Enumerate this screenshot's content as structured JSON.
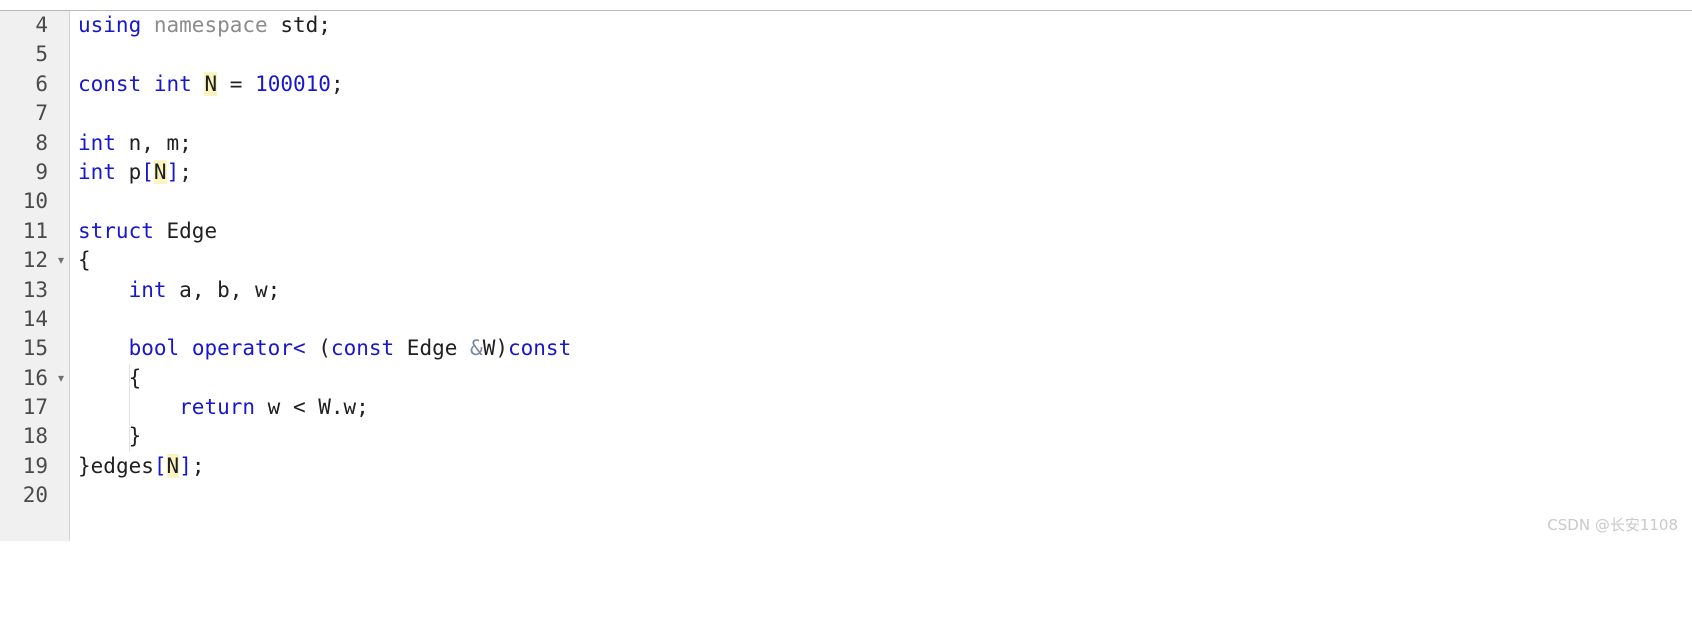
{
  "editor": {
    "language": "cpp",
    "first_visible_line": 4,
    "last_visible_line": 20,
    "gutter_bg": "#f0f0f0",
    "background": "#ffffff",
    "keyword_color": "#1717cf",
    "identifier_color": "#202020",
    "dimmed_color": "#8b8b8b",
    "occurrence_highlight_color": "#fbf3c0",
    "indent_guide_color": "#e2e2e2",
    "fold_marker": "▾"
  },
  "lines": [
    {
      "n": "4",
      "fold": "",
      "text": "using namespace std;"
    },
    {
      "n": "5",
      "fold": "",
      "text": ""
    },
    {
      "n": "6",
      "fold": "",
      "text": "const int N = 100010;"
    },
    {
      "n": "7",
      "fold": "",
      "text": ""
    },
    {
      "n": "8",
      "fold": "",
      "text": "int n, m;"
    },
    {
      "n": "9",
      "fold": "",
      "text": "int p[N];"
    },
    {
      "n": "10",
      "fold": "",
      "text": ""
    },
    {
      "n": "11",
      "fold": "",
      "text": "struct Edge"
    },
    {
      "n": "12",
      "fold": "▾",
      "text": "{"
    },
    {
      "n": "13",
      "fold": "",
      "text": "    int a, b, w;"
    },
    {
      "n": "14",
      "fold": "",
      "text": ""
    },
    {
      "n": "15",
      "fold": "",
      "text": "    bool operator< (const Edge &W)const"
    },
    {
      "n": "16",
      "fold": "▾",
      "text": "    {"
    },
    {
      "n": "17",
      "fold": "",
      "text": "        return w < W.w;"
    },
    {
      "n": "18",
      "fold": "",
      "text": "    }"
    },
    {
      "n": "19",
      "fold": "",
      "text": "}edges[N];"
    },
    {
      "n": "20",
      "fold": "",
      "text": ""
    }
  ],
  "watermark": {
    "text": "CSDN @长安1108"
  }
}
